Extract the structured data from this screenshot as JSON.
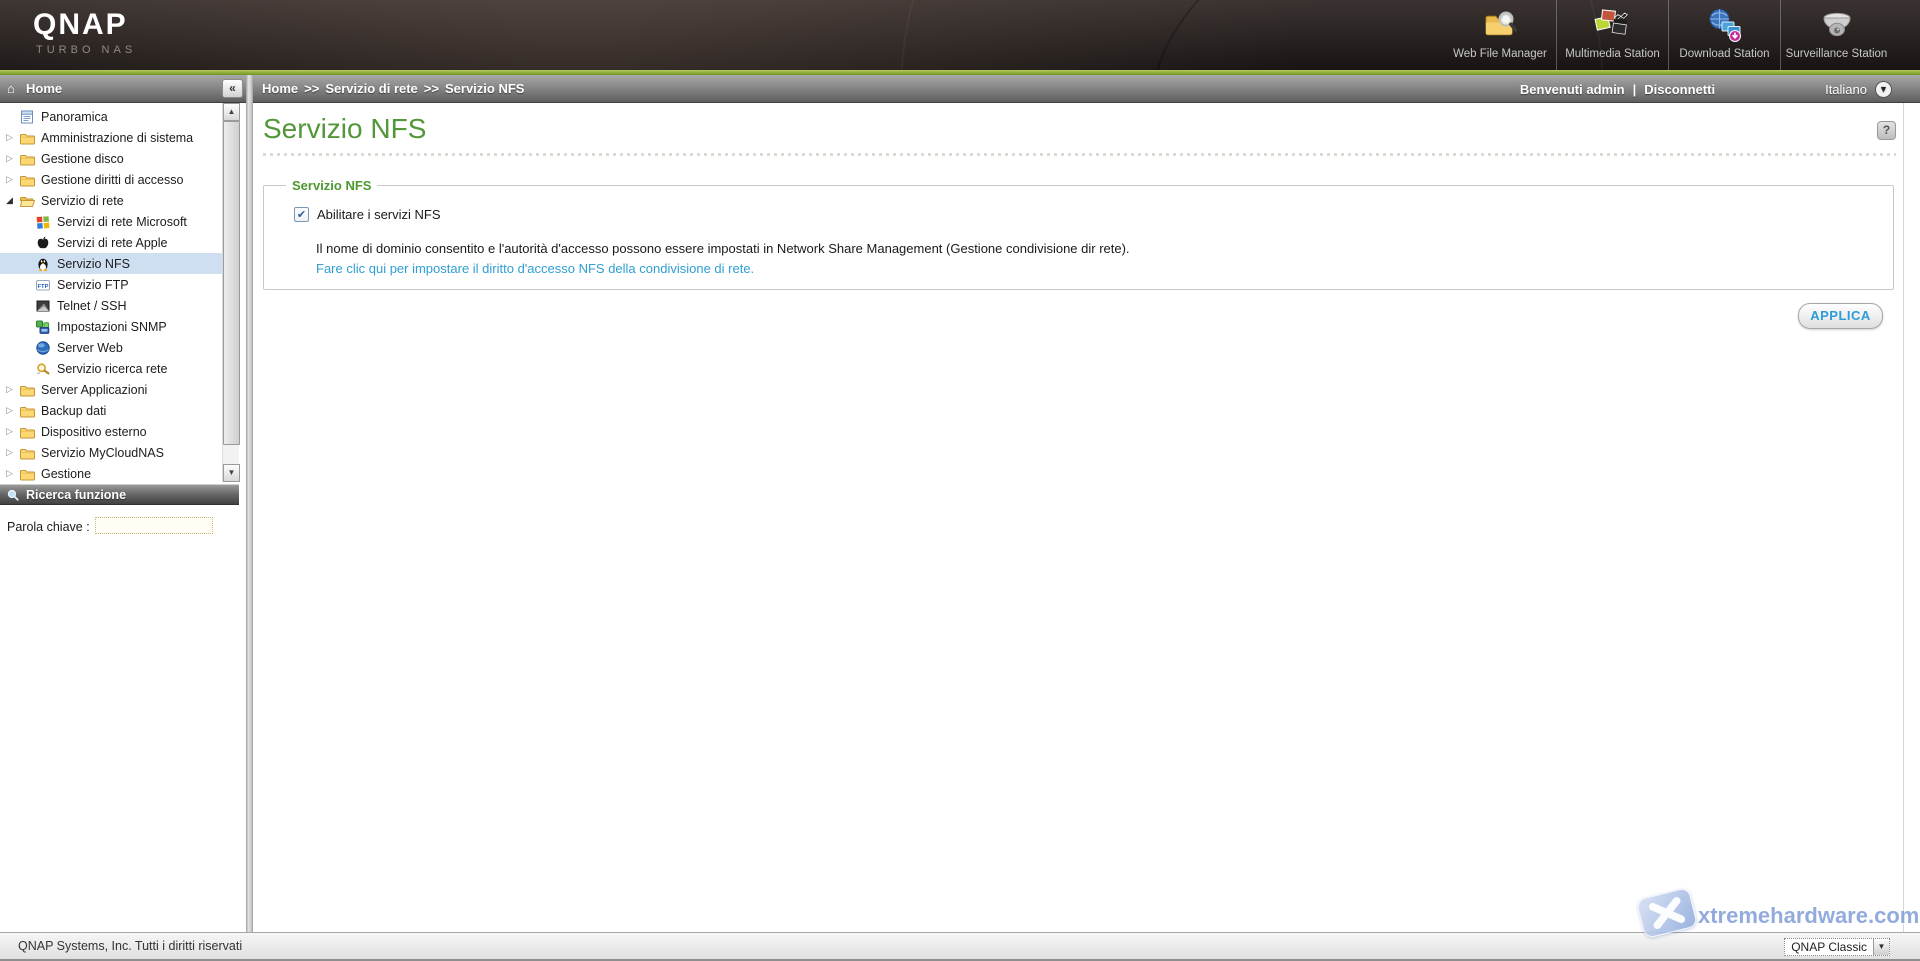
{
  "colors": {
    "accent_green": "#8aa832",
    "title_green": "#54973a",
    "legend_green": "#4c9a2f",
    "link_blue": "#2f9fd4",
    "apply_blue": "#2b9cd8",
    "selected_row": "#cfdff2"
  },
  "icons": {
    "collapse": "«",
    "lang_arrow": "▼",
    "help": "?",
    "select_arrow": "▼",
    "scroll_up": "▲",
    "scroll_down": "▼",
    "tree_collapsed": "▷",
    "tree_expanded": "◢",
    "checkbox_check": "✔",
    "home": "⌂"
  },
  "header": {
    "logo": "QNAP",
    "logo_sub": "TURBO NAS",
    "stations": [
      {
        "label": "Web File Manager",
        "icon": "web-file-manager"
      },
      {
        "label": "Multimedia Station",
        "icon": "multimedia-station"
      },
      {
        "label": "Download Station",
        "icon": "download-station"
      },
      {
        "label": "Surveillance Station",
        "icon": "surveillance-station"
      }
    ]
  },
  "topbar": {
    "sidebar_title": "Home",
    "breadcrumb_parts": [
      "Home",
      "Servizio di rete",
      "Servizio NFS"
    ],
    "breadcrumb_sep": ">>",
    "welcome": "Benvenuti admin",
    "separator": "|",
    "logout": "Disconnetti",
    "language": "Italiano"
  },
  "sidebar": {
    "tree": [
      {
        "label": "Panoramica",
        "icon": "overview",
        "level": 0,
        "expand": "none"
      },
      {
        "label": "Amministrazione di sistema",
        "icon": "folder",
        "level": 0,
        "expand": "collapsed"
      },
      {
        "label": "Gestione disco",
        "icon": "folder",
        "level": 0,
        "expand": "collapsed"
      },
      {
        "label": "Gestione diritti di accesso",
        "icon": "folder",
        "level": 0,
        "expand": "collapsed"
      },
      {
        "label": "Servizio di rete",
        "icon": "folder-open",
        "level": 0,
        "expand": "expanded"
      },
      {
        "label": "Servizi di rete Microsoft",
        "icon": "windows",
        "level": 1,
        "expand": "none"
      },
      {
        "label": "Servizi di rete Apple",
        "icon": "apple",
        "level": 1,
        "expand": "none"
      },
      {
        "label": "Servizio NFS",
        "icon": "linux",
        "level": 1,
        "expand": "none",
        "selected": true
      },
      {
        "label": "Servizio FTP",
        "icon": "ftp",
        "level": 1,
        "expand": "none"
      },
      {
        "label": "Telnet / SSH",
        "icon": "telnet",
        "level": 1,
        "expand": "none"
      },
      {
        "label": "Impostazioni SNMP",
        "icon": "snmp",
        "level": 1,
        "expand": "none"
      },
      {
        "label": "Server Web",
        "icon": "globe",
        "level": 1,
        "expand": "none"
      },
      {
        "label": "Servizio ricerca rete",
        "icon": "net-search",
        "level": 1,
        "expand": "none"
      },
      {
        "label": "Server Applicazioni",
        "icon": "folder",
        "level": 0,
        "expand": "collapsed"
      },
      {
        "label": "Backup dati",
        "icon": "folder",
        "level": 0,
        "expand": "collapsed"
      },
      {
        "label": "Dispositivo esterno",
        "icon": "folder",
        "level": 0,
        "expand": "collapsed"
      },
      {
        "label": "Servizio MyCloudNAS",
        "icon": "folder",
        "level": 0,
        "expand": "collapsed"
      },
      {
        "label": "Gestione",
        "icon": "folder",
        "level": 0,
        "expand": "collapsed"
      }
    ],
    "search_panel": {
      "title": "Ricerca funzione",
      "keyword_label": "Parola chiave :",
      "keyword_value": ""
    }
  },
  "main": {
    "title": "Servizio NFS",
    "section": {
      "legend": "Servizio NFS",
      "checkbox_label": "Abilitare i servizi NFS",
      "checkbox_checked": true,
      "description": "Il nome di dominio consentito e l'autorità d'accesso possono essere impostati in Network Share Management (Gestione condivisione dir rete).",
      "link": "Fare clic qui per impostare il diritto d'accesso NFS della condivisione di rete."
    },
    "apply_button": "APPLICA"
  },
  "footer": {
    "copyright": "QNAP Systems, Inc. Tutti i diritti riservati",
    "theme_select": "QNAP Classic"
  },
  "watermark": {
    "text": "xtremehardware.com"
  }
}
